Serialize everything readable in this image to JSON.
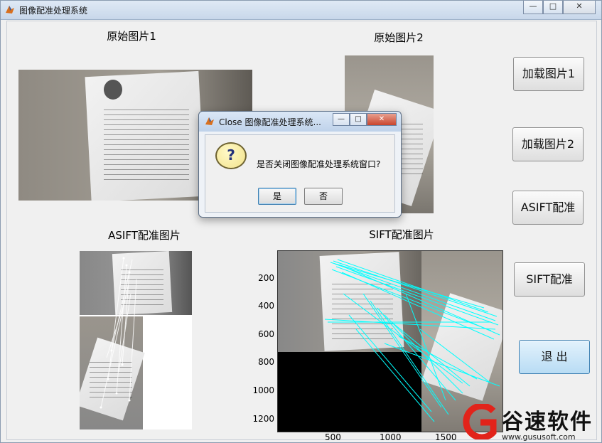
{
  "window": {
    "title": "图像配准处理系统",
    "controls": [
      "—",
      "□",
      "✕"
    ]
  },
  "labels": {
    "orig1": "原始图片1",
    "orig2": "原始图片2",
    "asift": "ASIFT配准图片",
    "sift": "SIFT配准图片"
  },
  "buttons": {
    "load1": "加载图片1",
    "load2": "加载图片2",
    "asift": "ASIFT配准",
    "sift": "SIFT配准",
    "exit": "退 出"
  },
  "axes": {
    "yticks": [
      "200",
      "400",
      "600",
      "800",
      "1000",
      "1200"
    ],
    "xticks": [
      "500",
      "1000",
      "1500"
    ]
  },
  "dialog": {
    "title": "Close 图像配准处理系统...",
    "message": "是否关闭图像配准处理系统窗口?",
    "yes": "是",
    "no": "否",
    "question_mark": "?"
  },
  "watermark": {
    "brand": "谷速软件",
    "url": "www.gususoft.com"
  },
  "colors": {
    "match_lines": "#00ffff",
    "exit_button": "#b8dcf4"
  }
}
